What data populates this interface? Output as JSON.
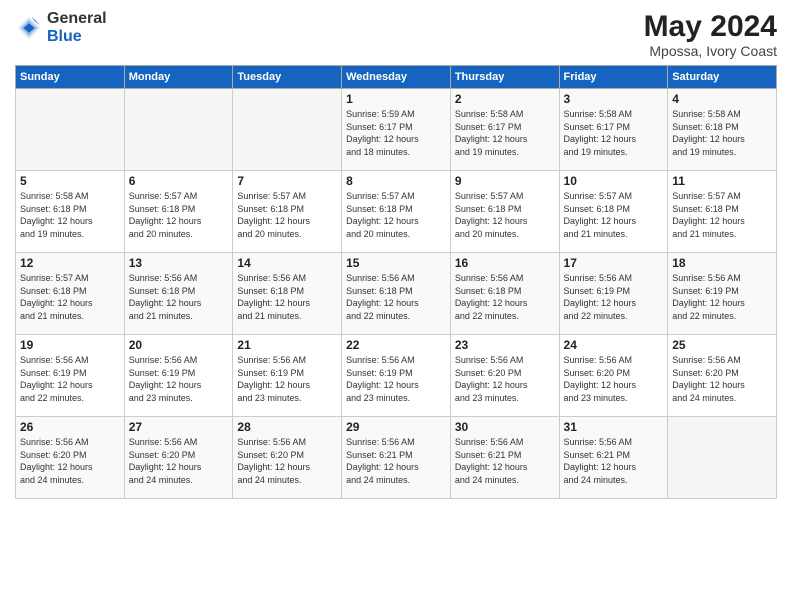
{
  "header": {
    "logo_general": "General",
    "logo_blue": "Blue",
    "title": "May 2024",
    "location": "Mpossa, Ivory Coast"
  },
  "days_of_week": [
    "Sunday",
    "Monday",
    "Tuesday",
    "Wednesday",
    "Thursday",
    "Friday",
    "Saturday"
  ],
  "weeks": [
    [
      {
        "num": "",
        "info": ""
      },
      {
        "num": "",
        "info": ""
      },
      {
        "num": "",
        "info": ""
      },
      {
        "num": "1",
        "info": "Sunrise: 5:59 AM\nSunset: 6:17 PM\nDaylight: 12 hours\nand 18 minutes."
      },
      {
        "num": "2",
        "info": "Sunrise: 5:58 AM\nSunset: 6:17 PM\nDaylight: 12 hours\nand 19 minutes."
      },
      {
        "num": "3",
        "info": "Sunrise: 5:58 AM\nSunset: 6:17 PM\nDaylight: 12 hours\nand 19 minutes."
      },
      {
        "num": "4",
        "info": "Sunrise: 5:58 AM\nSunset: 6:18 PM\nDaylight: 12 hours\nand 19 minutes."
      }
    ],
    [
      {
        "num": "5",
        "info": "Sunrise: 5:58 AM\nSunset: 6:18 PM\nDaylight: 12 hours\nand 19 minutes."
      },
      {
        "num": "6",
        "info": "Sunrise: 5:57 AM\nSunset: 6:18 PM\nDaylight: 12 hours\nand 20 minutes."
      },
      {
        "num": "7",
        "info": "Sunrise: 5:57 AM\nSunset: 6:18 PM\nDaylight: 12 hours\nand 20 minutes."
      },
      {
        "num": "8",
        "info": "Sunrise: 5:57 AM\nSunset: 6:18 PM\nDaylight: 12 hours\nand 20 minutes."
      },
      {
        "num": "9",
        "info": "Sunrise: 5:57 AM\nSunset: 6:18 PM\nDaylight: 12 hours\nand 20 minutes."
      },
      {
        "num": "10",
        "info": "Sunrise: 5:57 AM\nSunset: 6:18 PM\nDaylight: 12 hours\nand 21 minutes."
      },
      {
        "num": "11",
        "info": "Sunrise: 5:57 AM\nSunset: 6:18 PM\nDaylight: 12 hours\nand 21 minutes."
      }
    ],
    [
      {
        "num": "12",
        "info": "Sunrise: 5:57 AM\nSunset: 6:18 PM\nDaylight: 12 hours\nand 21 minutes."
      },
      {
        "num": "13",
        "info": "Sunrise: 5:56 AM\nSunset: 6:18 PM\nDaylight: 12 hours\nand 21 minutes."
      },
      {
        "num": "14",
        "info": "Sunrise: 5:56 AM\nSunset: 6:18 PM\nDaylight: 12 hours\nand 21 minutes."
      },
      {
        "num": "15",
        "info": "Sunrise: 5:56 AM\nSunset: 6:18 PM\nDaylight: 12 hours\nand 22 minutes."
      },
      {
        "num": "16",
        "info": "Sunrise: 5:56 AM\nSunset: 6:18 PM\nDaylight: 12 hours\nand 22 minutes."
      },
      {
        "num": "17",
        "info": "Sunrise: 5:56 AM\nSunset: 6:19 PM\nDaylight: 12 hours\nand 22 minutes."
      },
      {
        "num": "18",
        "info": "Sunrise: 5:56 AM\nSunset: 6:19 PM\nDaylight: 12 hours\nand 22 minutes."
      }
    ],
    [
      {
        "num": "19",
        "info": "Sunrise: 5:56 AM\nSunset: 6:19 PM\nDaylight: 12 hours\nand 22 minutes."
      },
      {
        "num": "20",
        "info": "Sunrise: 5:56 AM\nSunset: 6:19 PM\nDaylight: 12 hours\nand 23 minutes."
      },
      {
        "num": "21",
        "info": "Sunrise: 5:56 AM\nSunset: 6:19 PM\nDaylight: 12 hours\nand 23 minutes."
      },
      {
        "num": "22",
        "info": "Sunrise: 5:56 AM\nSunset: 6:19 PM\nDaylight: 12 hours\nand 23 minutes."
      },
      {
        "num": "23",
        "info": "Sunrise: 5:56 AM\nSunset: 6:20 PM\nDaylight: 12 hours\nand 23 minutes."
      },
      {
        "num": "24",
        "info": "Sunrise: 5:56 AM\nSunset: 6:20 PM\nDaylight: 12 hours\nand 23 minutes."
      },
      {
        "num": "25",
        "info": "Sunrise: 5:56 AM\nSunset: 6:20 PM\nDaylight: 12 hours\nand 24 minutes."
      }
    ],
    [
      {
        "num": "26",
        "info": "Sunrise: 5:56 AM\nSunset: 6:20 PM\nDaylight: 12 hours\nand 24 minutes."
      },
      {
        "num": "27",
        "info": "Sunrise: 5:56 AM\nSunset: 6:20 PM\nDaylight: 12 hours\nand 24 minutes."
      },
      {
        "num": "28",
        "info": "Sunrise: 5:56 AM\nSunset: 6:20 PM\nDaylight: 12 hours\nand 24 minutes."
      },
      {
        "num": "29",
        "info": "Sunrise: 5:56 AM\nSunset: 6:21 PM\nDaylight: 12 hours\nand 24 minutes."
      },
      {
        "num": "30",
        "info": "Sunrise: 5:56 AM\nSunset: 6:21 PM\nDaylight: 12 hours\nand 24 minutes."
      },
      {
        "num": "31",
        "info": "Sunrise: 5:56 AM\nSunset: 6:21 PM\nDaylight: 12 hours\nand 24 minutes."
      },
      {
        "num": "",
        "info": ""
      }
    ]
  ]
}
